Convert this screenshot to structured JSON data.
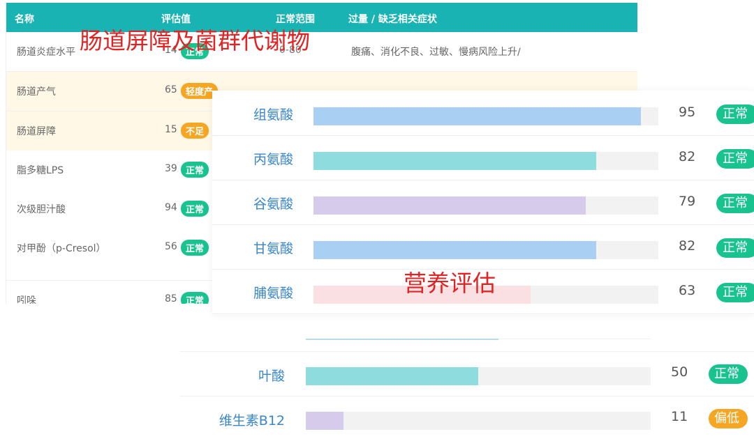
{
  "table": {
    "headers": [
      "名称",
      "评估值",
      "正常范围",
      "过量 / 缺乏相关症状"
    ],
    "rows": [
      {
        "name": "肠道炎症水平",
        "value": "14",
        "status": "正常",
        "range": "0-80",
        "symptoms": "腹痛、消化不良、过敏、慢病风险上升/"
      },
      {
        "name": "肠道产气",
        "value": "65",
        "status": "轻度产",
        "range": "",
        "symptoms": ""
      },
      {
        "name": "肠道屏障",
        "value": "15",
        "status": "不足",
        "range": "",
        "symptoms": ""
      },
      {
        "name": "脂多糖LPS",
        "value": "39",
        "status": "正常",
        "range": "",
        "symptoms": ""
      },
      {
        "name": "次级胆汁酸",
        "value": "94",
        "status": "正常",
        "range": "",
        "symptoms": ""
      },
      {
        "name": "对甲酚（p-Cresol）",
        "value": "56",
        "status": "正常",
        "range": "",
        "symptoms": ""
      },
      {
        "name": "吲哚",
        "value": "85",
        "status": "正常",
        "range": "",
        "symptoms": ""
      }
    ]
  },
  "overlay_title": "肠道屏障及菌群代谢物",
  "nutrition_title": "营养评估",
  "amino_acids": [
    {
      "name": "组氨酸",
      "value": "95",
      "status": "正常",
      "fill": 0.95,
      "color": "#a9d0f2"
    },
    {
      "name": "丙氨酸",
      "value": "82",
      "status": "正常",
      "fill": 0.82,
      "color": "#8fdcdf"
    },
    {
      "name": "谷氨酸",
      "value": "79",
      "status": "正常",
      "fill": 0.79,
      "color": "#d6cbea"
    },
    {
      "name": "甘氨酸",
      "value": "82",
      "status": "正常",
      "fill": 0.82,
      "color": "#a9d0f2"
    },
    {
      "name": "脯氨酸",
      "value": "63",
      "status": "正常",
      "fill": 0.63,
      "color": "#fbe0e3"
    }
  ],
  "vitamins": [
    {
      "name": "叶酸",
      "value": "50",
      "status": "正常",
      "fill": 0.5,
      "color": "#8fdcdf"
    },
    {
      "name": "维生素B12",
      "value": "11",
      "status": "偏低",
      "fill": 0.11,
      "color": "#d6cbea"
    }
  ],
  "colors": {
    "header_teal": "#1ab3b3",
    "status_normal": "#19c38f",
    "status_warn": "#f5a623",
    "title_red": "#e02424",
    "label_blue": "#3a86c8"
  }
}
